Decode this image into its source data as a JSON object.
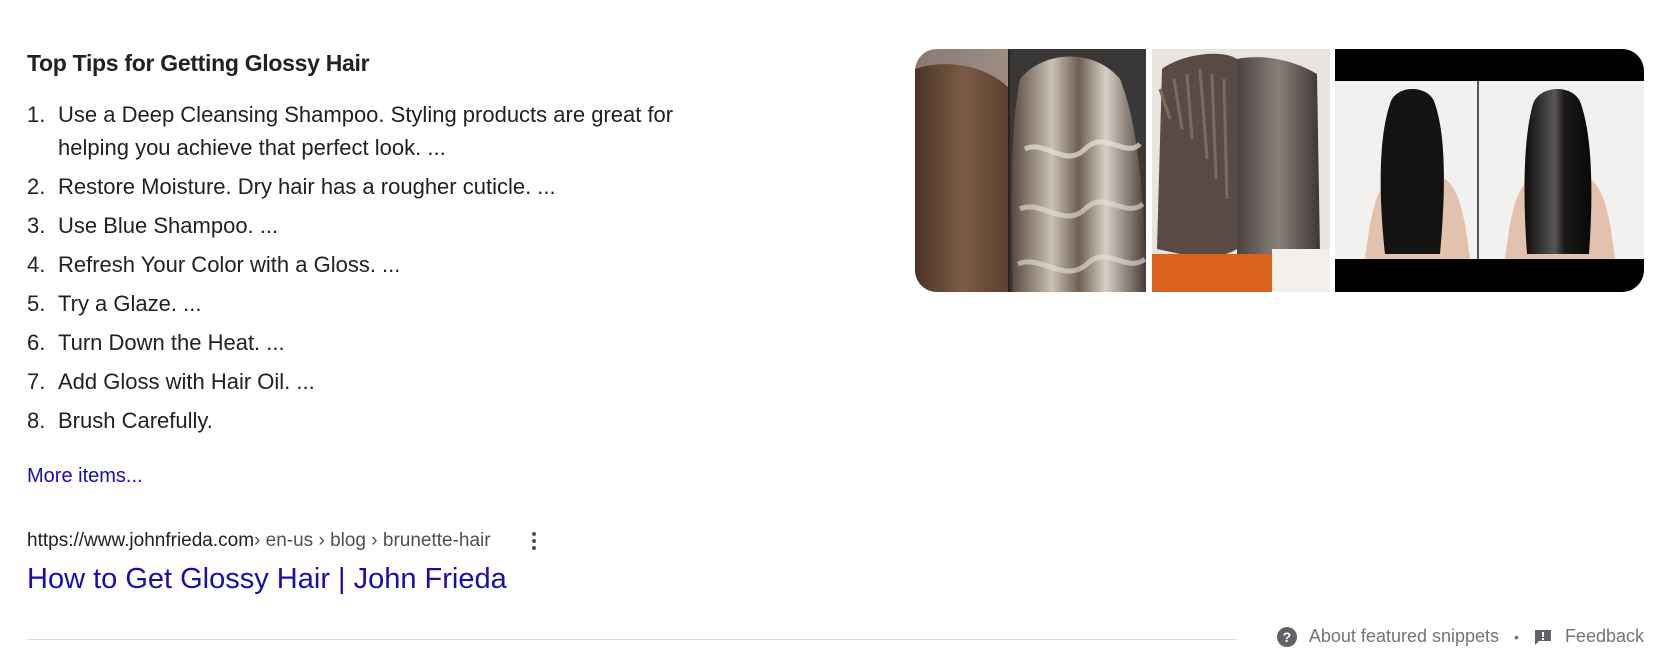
{
  "snippet": {
    "title": "Top Tips for Getting Glossy Hair",
    "tips": [
      {
        "num": "1.",
        "text": "Use a Deep Cleansing Shampoo. Styling products are great for helping you achieve that perfect look. ..."
      },
      {
        "num": "2.",
        "text": "Restore Moisture. Dry hair has a rougher cuticle. ..."
      },
      {
        "num": "3.",
        "text": "Use Blue Shampoo. ..."
      },
      {
        "num": "4.",
        "text": "Refresh Your Color with a Gloss. ..."
      },
      {
        "num": "5.",
        "text": "Try a Glaze. ..."
      },
      {
        "num": "6.",
        "text": "Turn Down the Heat. ..."
      },
      {
        "num": "7.",
        "text": "Add Gloss with Hair Oil. ..."
      },
      {
        "num": "8.",
        "text": "Brush Carefully."
      }
    ],
    "more_items": "More items..."
  },
  "result": {
    "url_domain": "https://www.johnfrieda.com",
    "url_path": " › en-us › blog › brunette-hair",
    "title": "How to Get Glossy Hair | John Frieda"
  },
  "footer": {
    "about": "About featured snippets",
    "separator": "•",
    "feedback": "Feedback"
  },
  "images": [
    {
      "icon": "before-after-brunette-waves-photo"
    },
    {
      "icon": "frizzy-vs-smooth-hair-photo"
    },
    {
      "icon": "dull-vs-glossy-black-hair-photo"
    }
  ],
  "colors": {
    "link": "#1a0dab",
    "text": "#202124",
    "muted": "#70757a"
  }
}
